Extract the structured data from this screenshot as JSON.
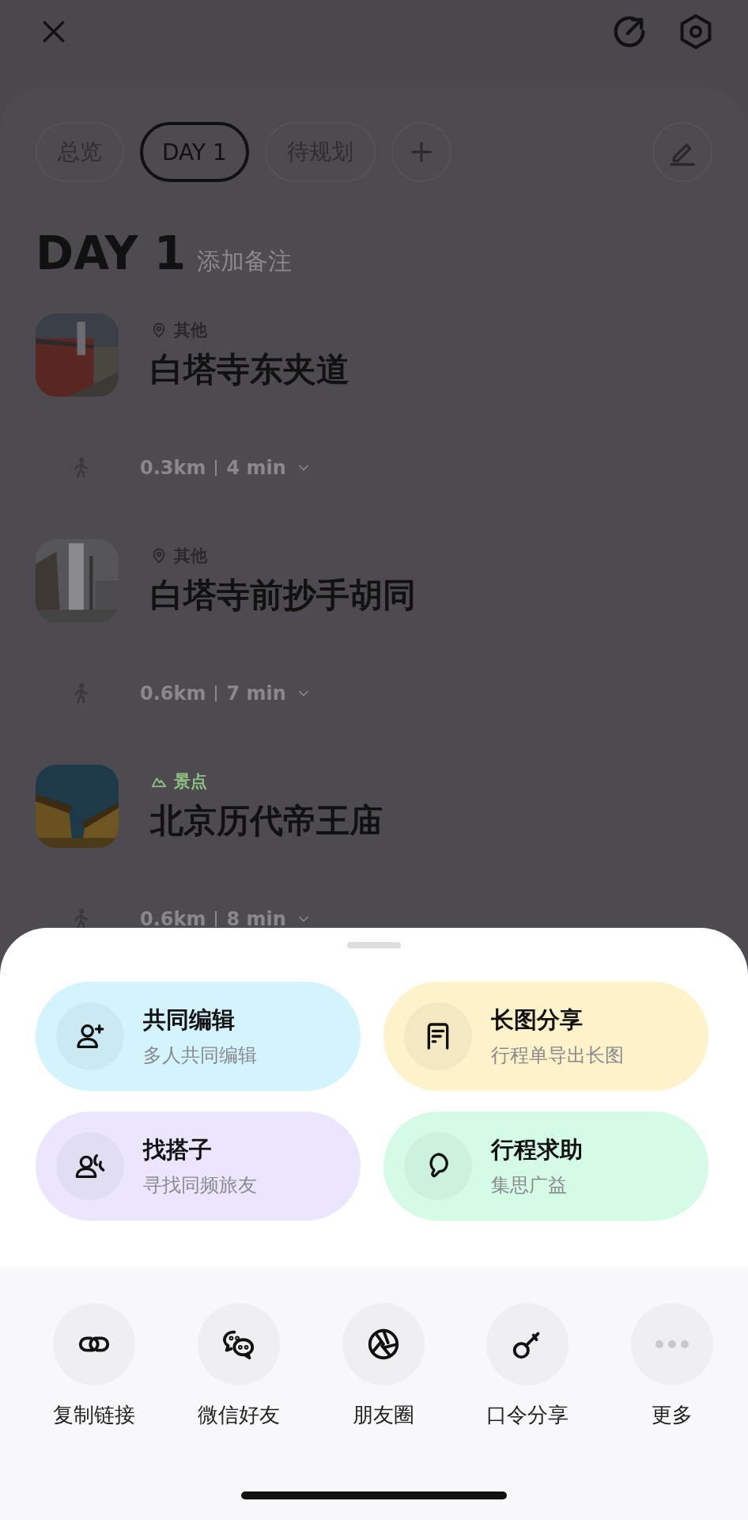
{
  "tabs": [
    {
      "label": "总览",
      "selected": false
    },
    {
      "label": "DAY 1",
      "selected": true
    },
    {
      "label": "待规划",
      "selected": false
    }
  ],
  "day": {
    "title": "DAY 1",
    "placeholder": "添加备注"
  },
  "stops": [
    {
      "kind": "other",
      "category": "其他",
      "title": "白塔寺东夹道",
      "leg": {
        "distance": "0.3km",
        "duration": "4 min"
      }
    },
    {
      "kind": "other",
      "category": "其他",
      "title": "白塔寺前抄手胡同",
      "leg": {
        "distance": "0.6km",
        "duration": "7 min"
      }
    },
    {
      "kind": "sight",
      "category": "景点",
      "title": "北京历代帝王庙",
      "leg": {
        "distance": "0.6km",
        "duration": "8 min"
      }
    }
  ],
  "actions": [
    {
      "kind": "co-edit",
      "title": "共同编辑",
      "subtitle": "多人共同编辑",
      "color": "#d3f3fd"
    },
    {
      "kind": "long-image",
      "title": "长图分享",
      "subtitle": "行程单导出长图",
      "color": "#fdf2c9"
    },
    {
      "kind": "partner",
      "title": "找搭子",
      "subtitle": "寻找同频旅友",
      "color": "#ebe6fd"
    },
    {
      "kind": "help",
      "title": "行程求助",
      "subtitle": "集思广益",
      "color": "#d5fbe6"
    }
  ],
  "share": [
    {
      "kind": "link",
      "label": "复制链接"
    },
    {
      "kind": "wechat",
      "label": "微信好友"
    },
    {
      "kind": "moments",
      "label": "朋友圈"
    },
    {
      "kind": "key",
      "label": "口令分享"
    },
    {
      "kind": "more",
      "label": "更多"
    }
  ]
}
